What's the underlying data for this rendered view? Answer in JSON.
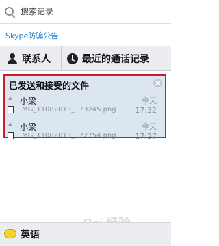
{
  "search": {
    "placeholder": "搜索记录"
  },
  "notice": {
    "link": "Skype防骗公告"
  },
  "tabs": {
    "contacts": "联系人",
    "recent": "最近的通话记录"
  },
  "transfers": {
    "title": "已发送和接受的文件",
    "items": [
      {
        "sender": "小梁",
        "filename": "IMG_11082013_173245.png",
        "day": "今天",
        "time": "17:32"
      },
      {
        "sender": "小梁",
        "filename": "IMG_11082013_172754.png",
        "day": "今天",
        "time": "17:27"
      }
    ]
  },
  "bottom": {
    "label": "英语"
  },
  "watermark": {
    "text": "Bai 经验"
  }
}
